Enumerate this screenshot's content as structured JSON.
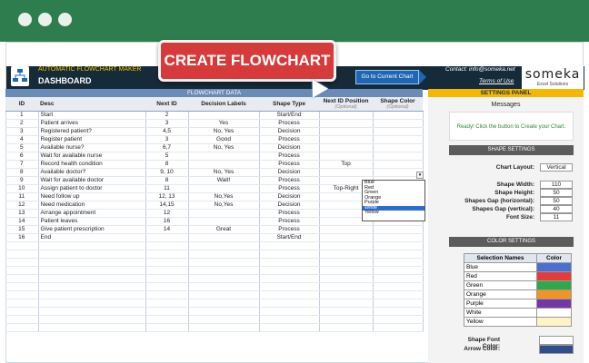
{
  "window": {
    "titlebar_color": "#2e7d4f"
  },
  "header": {
    "app_title": "AUTOMATIC FLOWCHART MAKER",
    "dashboard_title": "DASHBOARD",
    "goto_button": "Go to Current Chart",
    "contact": "Contact: info@someka.net",
    "terms": "Terms of Use",
    "brand": "someka",
    "brand_sub": "Excel Solutions",
    "create_button": "CREATE FLOWCHART"
  },
  "flowchart_data": {
    "section_title": "FLOWCHART DATA",
    "columns": {
      "id": "ID",
      "desc": "Desc",
      "next_id": "Next ID",
      "labels": "Decision Labels",
      "shape_type": "Shape Type",
      "next_pos": "Next ID Position",
      "next_pos_sub": "(Optional)",
      "shape_color": "Shape Color",
      "shape_color_sub": "(Optional)"
    },
    "rows": [
      {
        "id": "1",
        "desc": "Start",
        "next": "2",
        "labels": "",
        "type": "Start/End",
        "pos": "",
        "color": ""
      },
      {
        "id": "2",
        "desc": "Patient arrives",
        "next": "3",
        "labels": "Yes",
        "type": "Process",
        "pos": "",
        "color": ""
      },
      {
        "id": "3",
        "desc": "Registered patient?",
        "next": "4,5",
        "labels": "No, Yes",
        "type": "Decision",
        "pos": "",
        "color": ""
      },
      {
        "id": "4",
        "desc": "Register patient",
        "next": "3",
        "labels": "Good",
        "type": "Process",
        "pos": "",
        "color": ""
      },
      {
        "id": "5",
        "desc": "Available nurse?",
        "next": "6,7",
        "labels": "No, Yes",
        "type": "Decision",
        "pos": "",
        "color": ""
      },
      {
        "id": "6",
        "desc": "Wait for available nurse",
        "next": "5",
        "labels": "",
        "type": "Process",
        "pos": "",
        "color": ""
      },
      {
        "id": "7",
        "desc": "Record health condition",
        "next": "8",
        "labels": "",
        "type": "Process",
        "pos": "Top",
        "color": ""
      },
      {
        "id": "8",
        "desc": "Available doctor?",
        "next": "9, 10",
        "labels": "No, Yes",
        "type": "Decision",
        "pos": "",
        "color": ""
      },
      {
        "id": "9",
        "desc": "Wait for available doctor",
        "next": "8",
        "labels": "Wait!",
        "type": "Process",
        "pos": "",
        "color": ""
      },
      {
        "id": "10",
        "desc": "Assign patient to doctor",
        "next": "11",
        "labels": "",
        "type": "Process",
        "pos": "Top-Right",
        "color": ""
      },
      {
        "id": "11",
        "desc": "Need follow up",
        "next": "12, 13",
        "labels": "No,Yes",
        "type": "Decision",
        "pos": "",
        "color": ""
      },
      {
        "id": "12",
        "desc": "Need medication",
        "next": "14,15",
        "labels": "No,Yes",
        "type": "Decision",
        "pos": "",
        "color": ""
      },
      {
        "id": "13",
        "desc": "Arrange appointment",
        "next": "12",
        "labels": "",
        "type": "Process",
        "pos": "",
        "color": ""
      },
      {
        "id": "14",
        "desc": "Patient leaves",
        "next": "16",
        "labels": "",
        "type": "Process",
        "pos": "",
        "color": ""
      },
      {
        "id": "15",
        "desc": "Give patient prescription",
        "next": "14",
        "labels": "Great",
        "type": "Process",
        "pos": "",
        "color": ""
      },
      {
        "id": "16",
        "desc": "End",
        "next": "",
        "labels": "",
        "type": "Start/End",
        "pos": "",
        "color": ""
      }
    ],
    "dropdown_options": [
      "Blue",
      "Red",
      "Green",
      "Orange",
      "Purple",
      "White",
      "Yellow"
    ],
    "dropdown_selected": "White"
  },
  "settings": {
    "panel_title": "SETTINGS PANEL",
    "messages_title": "Messages",
    "message": "Ready! Click the button to Create your Chart.",
    "shape_settings_title": "SHAPE SETTINGS",
    "chart_layout_label": "Chart Layout:",
    "chart_layout_value": "Vertical",
    "shape_width_label": "Shape Width:",
    "shape_width_value": "110",
    "shape_height_label": "Shape Height:",
    "shape_height_value": "50",
    "gap_h_label": "Shapes Gap (horizontal):",
    "gap_h_value": "50",
    "gap_v_label": "Shapes Gap (vertical):",
    "gap_v_value": "40",
    "font_size_label": "Font Size:",
    "font_size_value": "11",
    "color_settings_title": "COLOR SETTINGS",
    "selection_names_header": "Selection Names",
    "color_header": "Color",
    "colors": [
      {
        "name": "Blue",
        "hex": "#4a6fd3"
      },
      {
        "name": "Red",
        "hex": "#e53b3b"
      },
      {
        "name": "Green",
        "hex": "#2fa84a"
      },
      {
        "name": "Orange",
        "hex": "#f39323"
      },
      {
        "name": "Purple",
        "hex": "#7338a8"
      },
      {
        "name": "White",
        "hex": "#ffffff"
      },
      {
        "name": "Yellow",
        "hex": "#fff3c9"
      }
    ],
    "shape_font_color_label": "Shape Font Color:",
    "shape_font_color": "#ffffff",
    "arrow_color_label": "Arrow Color:",
    "arrow_color": "#2f4e8c"
  }
}
